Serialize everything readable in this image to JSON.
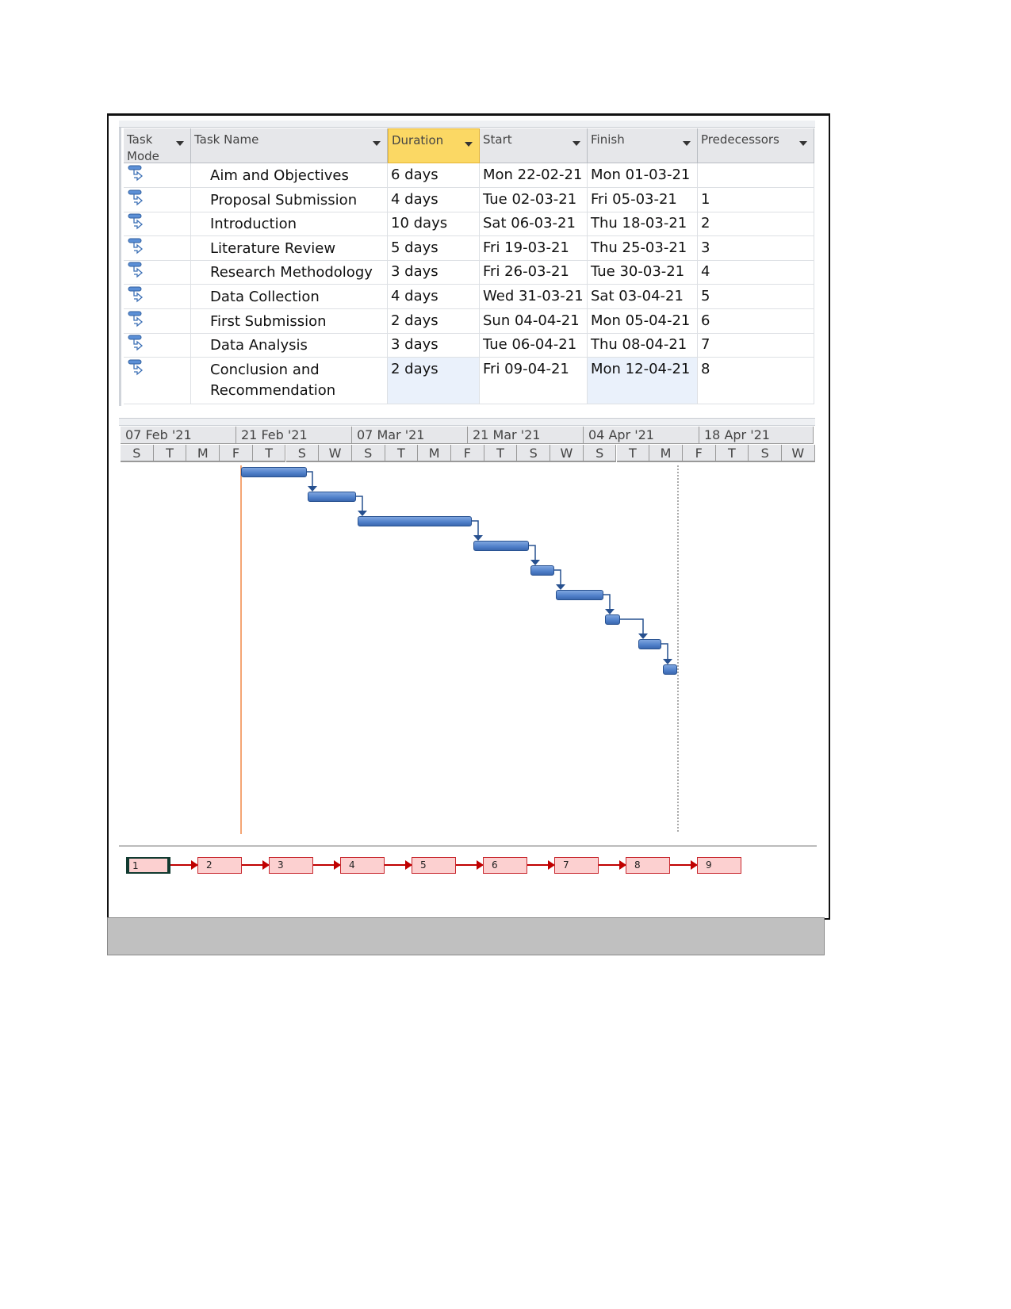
{
  "columns": [
    {
      "key": "mode",
      "label": "Task Mode"
    },
    {
      "key": "name",
      "label": "Task Name"
    },
    {
      "key": "duration",
      "label": "Duration"
    },
    {
      "key": "start",
      "label": "Start"
    },
    {
      "key": "finish",
      "label": "Finish"
    },
    {
      "key": "pred",
      "label": "Predecessors"
    }
  ],
  "tasks": [
    {
      "name": "Aim and Objectives",
      "duration": "6 days",
      "start": "Mon 22-02-21",
      "finish": "Mon 01-03-21",
      "pred": ""
    },
    {
      "name": "Proposal Submission",
      "duration": "4 days",
      "start": "Tue 02-03-21",
      "finish": "Fri 05-03-21",
      "pred": "1"
    },
    {
      "name": "Introduction",
      "duration": "10 days",
      "start": "Sat 06-03-21",
      "finish": "Thu 18-03-21",
      "pred": "2"
    },
    {
      "name": "Literature Review",
      "duration": "5 days",
      "start": "Fri 19-03-21",
      "finish": "Thu 25-03-21",
      "pred": "3"
    },
    {
      "name": "Research Methodology",
      "duration": "3 days",
      "start": "Fri 26-03-21",
      "finish": "Tue 30-03-21",
      "pred": "4"
    },
    {
      "name": "Data Collection",
      "duration": "4 days",
      "start": "Wed 31-03-21",
      "finish": "Sat 03-04-21",
      "pred": "5"
    },
    {
      "name": "First Submission",
      "duration": "2 days",
      "start": "Sun 04-04-21",
      "finish": "Mon 05-04-21",
      "pred": "6"
    },
    {
      "name": "Data Analysis",
      "duration": "3 days",
      "start": "Tue 06-04-21",
      "finish": "Thu 08-04-21",
      "pred": "7"
    },
    {
      "name": "Conclusion and Recommendation",
      "duration": "2 days",
      "start": "Fri 09-04-21",
      "finish": "Mon 12-04-21",
      "pred": "8"
    }
  ],
  "timescale": {
    "major": [
      "07 Feb '21",
      "21 Feb '21",
      "07 Mar '21",
      "21 Mar '21",
      "04 Apr '21",
      "18 Apr '21"
    ],
    "minor": [
      "S",
      "T",
      "M",
      "F",
      "T",
      "S",
      "W",
      "S",
      "T",
      "M",
      "F",
      "T",
      "S",
      "W",
      "S",
      "T",
      "M",
      "F",
      "T",
      "S",
      "W"
    ]
  },
  "network_nodes": [
    "1",
    "2",
    "3",
    "4",
    "5",
    "6",
    "7",
    "8",
    "9"
  ],
  "colors": {
    "bar": "#4f7fc9",
    "selected_header": "#fbd864",
    "today_line": "#f4a574",
    "network_node": "#fcd0d0",
    "network_link": "#c00000"
  },
  "icons": {
    "task_mode": "auto-scheduled-task-icon",
    "header_dropdown": "dropdown-arrow-icon"
  }
}
